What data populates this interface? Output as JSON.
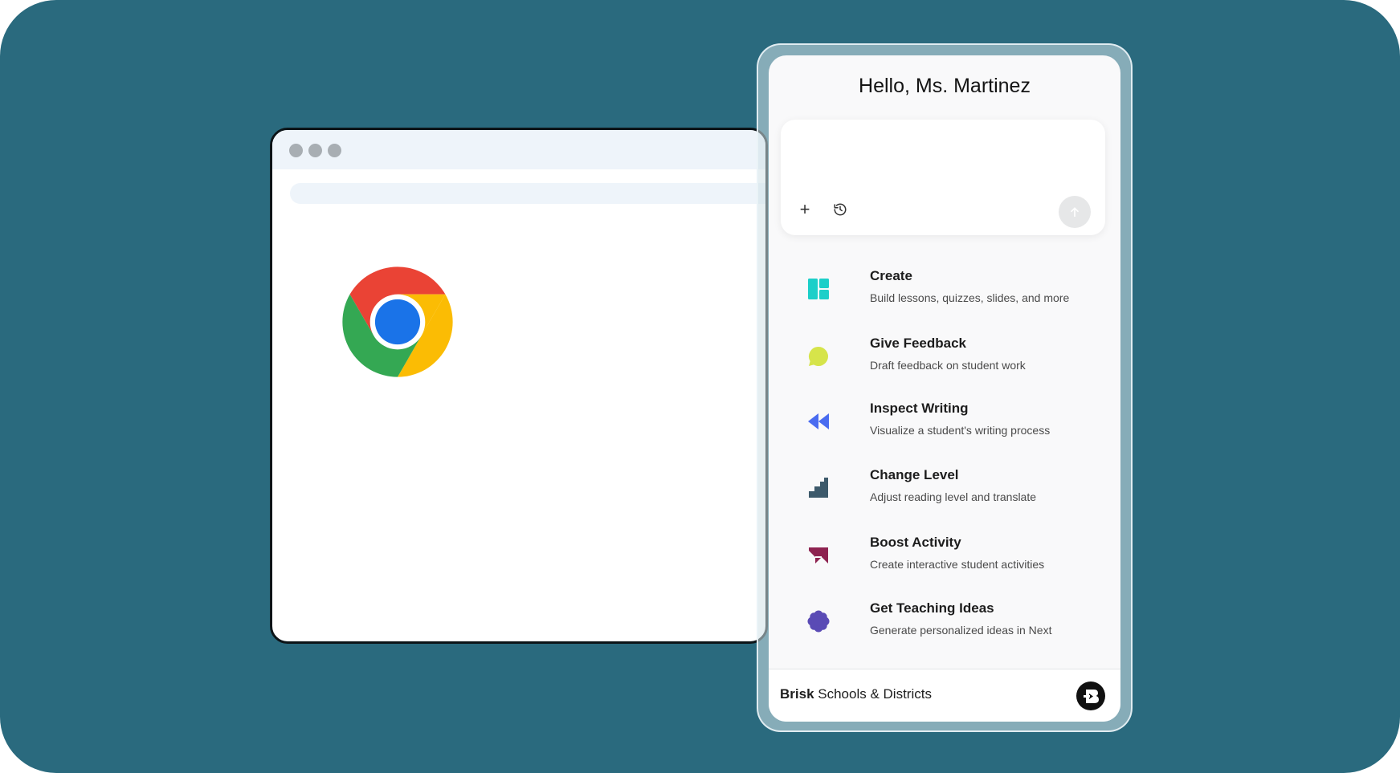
{
  "browser": {
    "logo_icon": "chrome-logo"
  },
  "panel": {
    "greeting": "Hello, Ms. Martinez",
    "prompt": {
      "placeholder": "",
      "add_icon": "plus-icon",
      "history_icon": "history-icon",
      "send_icon": "arrow-up-icon"
    },
    "tools": [
      {
        "title": "Create",
        "description": "Build lessons, quizzes, slides, and more",
        "icon": "layout-grid-icon",
        "color": "#1ccfc9"
      },
      {
        "title": "Give Feedback",
        "description": "Draft feedback on student work",
        "icon": "speech-bubble-icon",
        "color": "#d6e44a"
      },
      {
        "title": "Inspect Writing",
        "description": "Visualize a student's writing process",
        "icon": "rewind-icon",
        "color": "#4a6cf0"
      },
      {
        "title": "Change Level",
        "description": "Adjust reading level and translate",
        "icon": "stairs-icon",
        "color": "#3d5a6b"
      },
      {
        "title": "Boost Activity",
        "description": "Create interactive student activities",
        "icon": "arrow-boost-icon",
        "color": "#8e2350"
      },
      {
        "title": "Get Teaching Ideas",
        "description": "Generate personalized ideas in Next",
        "icon": "flower-icon",
        "color": "#5a4bb5"
      }
    ],
    "footer": {
      "brand": "Brisk",
      "label": " Schools & Districts",
      "logo_icon": "brisk-logo-icon"
    }
  },
  "colors": {
    "background": "#2a6a7e",
    "panel": "#f9f9fa"
  }
}
